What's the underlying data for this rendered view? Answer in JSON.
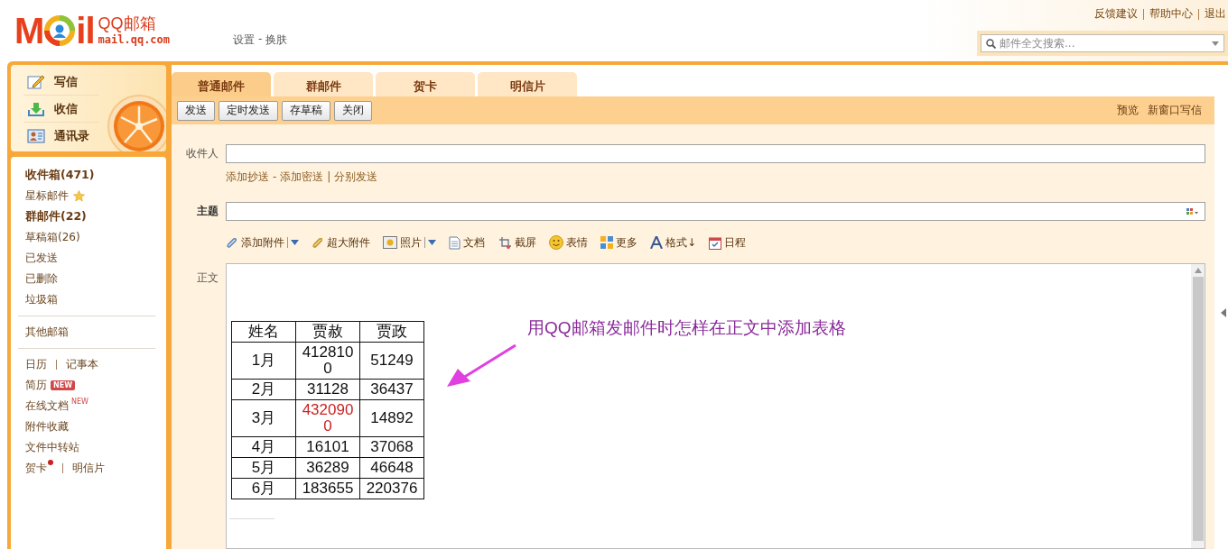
{
  "header": {
    "logo": {
      "mark_left": "M",
      "mark_right": "il",
      "name": "QQ邮箱",
      "domain": "mail.qq.com"
    },
    "account_links": [
      {
        "label": "设置",
        "sep": "-"
      },
      {
        "label": "换肤"
      }
    ],
    "top_links": [
      "反馈建议",
      "帮助中心",
      "退出"
    ],
    "search": {
      "placeholder": "邮件全文搜索..."
    }
  },
  "quick_actions": [
    {
      "label": "写信",
      "kind": "compose"
    },
    {
      "label": "收信",
      "kind": "inbox"
    },
    {
      "label": "通讯录",
      "kind": "contacts"
    }
  ],
  "folders": [
    {
      "label": "收件箱(471)",
      "bold": true
    },
    {
      "label": "星标邮件",
      "bold": false,
      "kind": "starred"
    },
    {
      "label": "群邮件(22)",
      "bold": true
    },
    {
      "label": "草稿箱(26)",
      "bold": false
    },
    {
      "label": "已发送",
      "bold": false
    },
    {
      "label": "已删除",
      "bold": false
    },
    {
      "label": "垃圾箱",
      "bold": false
    }
  ],
  "other_mailbox": "其他邮箱",
  "tools": [
    [
      {
        "label": "日历"
      },
      {
        "label": "记事本"
      }
    ],
    [
      {
        "label": "简历",
        "badge": {
          "text": "NEW",
          "kind": "tag"
        }
      }
    ],
    [
      {
        "label": "在线文档",
        "badge": {
          "text": "NEW",
          "kind": "sup"
        }
      }
    ],
    [
      {
        "label": "附件收藏"
      }
    ],
    [
      {
        "label": "文件中转站"
      }
    ],
    [
      {
        "label": "贺卡",
        "dot": true
      },
      {
        "label": "明信片"
      }
    ]
  ],
  "compose": {
    "tabs": [
      {
        "label": "普通邮件",
        "selected": true
      },
      {
        "label": "群邮件",
        "selected": false
      },
      {
        "label": "贺卡",
        "selected": false
      },
      {
        "label": "明信片",
        "selected": false
      }
    ],
    "buttons": [
      "发送",
      "定时发送",
      "存草稿",
      "关闭"
    ],
    "right_links": [
      "预览",
      "新窗口写信"
    ],
    "recipient": {
      "label": "收件人",
      "links": [
        {
          "label": "添加抄送",
          "sep": "-"
        },
        {
          "label": "添加密送",
          "sep": "|"
        },
        {
          "label": "分别发送"
        }
      ]
    },
    "subject": {
      "label": "主题"
    },
    "attach_tools": [
      {
        "label": "添加附件",
        "kind": "clip",
        "dropdown": true
      },
      {
        "label": "超大附件",
        "kind": "bigclip",
        "dropdown": false
      },
      {
        "label": "照片",
        "kind": "photo",
        "dropdown": true
      },
      {
        "label": "文档",
        "kind": "doc",
        "dropdown": false
      },
      {
        "label": "截屏",
        "kind": "screenshot",
        "dropdown": false
      },
      {
        "label": "表情",
        "kind": "smiley",
        "dropdown": false
      },
      {
        "label": "更多",
        "kind": "grid",
        "dropdown": false
      },
      {
        "label": "格式↓",
        "kind": "format",
        "dropdown": false
      },
      {
        "label": "日程",
        "kind": "calendar",
        "dropdown": false
      }
    ],
    "body": {
      "label": "正文",
      "table": {
        "columns": [
          "姓名",
          "贾赦",
          "贾政"
        ],
        "rows": [
          [
            "1月",
            "4128100",
            "51249"
          ],
          [
            "2月",
            "31128",
            "36437"
          ],
          [
            {
              "text": "3月"
            },
            {
              "text": "4320900",
              "color": "#cc2222"
            },
            {
              "text": "14892"
            }
          ],
          [
            "4月",
            "16101",
            "37068"
          ],
          [
            "5月",
            "36289",
            "46648"
          ],
          [
            "6月",
            "183655",
            "220376"
          ]
        ]
      },
      "annotation": "用QQ邮箱发邮件时怎样在正文中添加表格"
    }
  }
}
